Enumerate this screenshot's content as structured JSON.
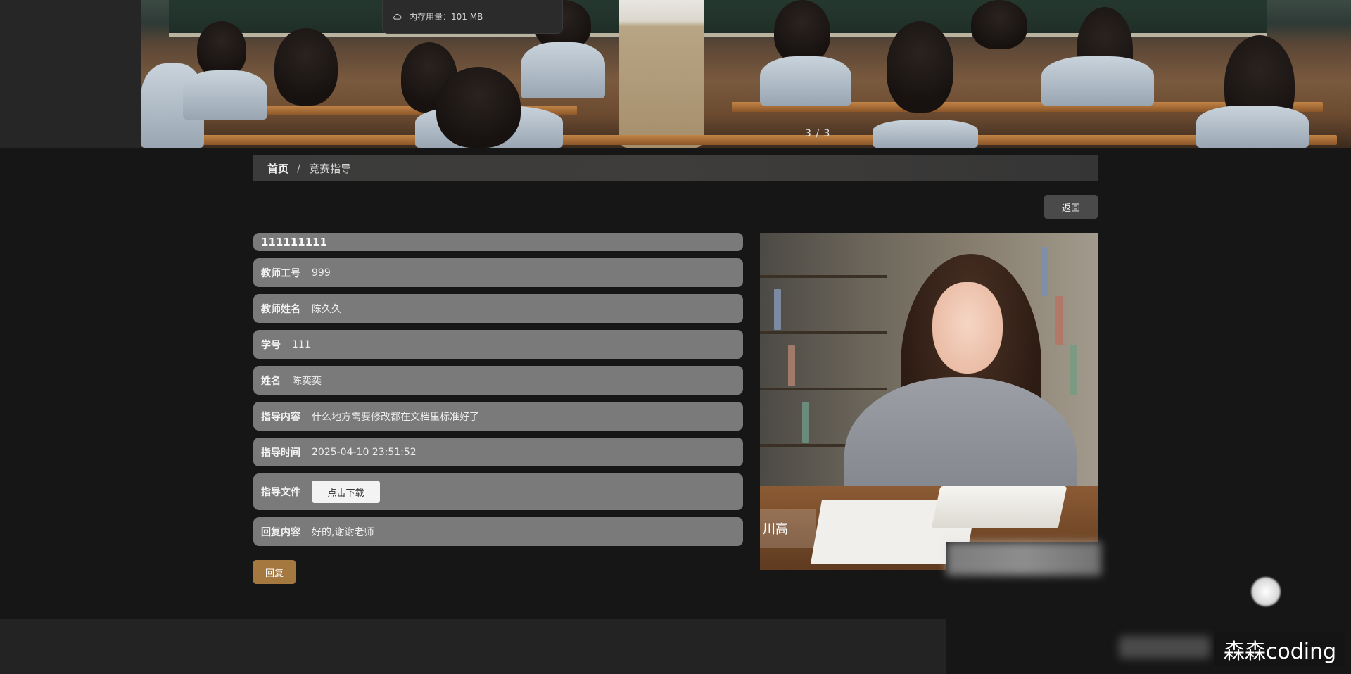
{
  "memory": {
    "label": "内存用量：101 MB"
  },
  "banner": {
    "indicator": "3 / 3"
  },
  "breadcrumb": {
    "home": "首页",
    "separator": "/",
    "current": "竞赛指导"
  },
  "actions": {
    "back": "返回",
    "reply": "回复"
  },
  "detail": {
    "title": "111111111",
    "fields": [
      {
        "label": "教师工号",
        "value": "999"
      },
      {
        "label": "教师姓名",
        "value": "陈久久"
      },
      {
        "label": "学号",
        "value": "111"
      },
      {
        "label": "姓名",
        "value": "陈奕奕"
      },
      {
        "label": "指导内容",
        "value": "什么地方需要修改都在文档里标准好了"
      },
      {
        "label": "指导时间",
        "value": "2025-04-10 23:51:52"
      }
    ],
    "file": {
      "label": "指导文件",
      "button": "点击下载"
    },
    "reply": {
      "label": "回复内容",
      "value": "好的,谢谢老师"
    }
  },
  "photo": {
    "watermark": "川高"
  },
  "watermark": {
    "text": "森森coding"
  },
  "colors": {
    "background": "#161616",
    "field_bg": "#7a7a7a",
    "reply_button": "#a5783f",
    "back_button": "#4a4a4a"
  }
}
